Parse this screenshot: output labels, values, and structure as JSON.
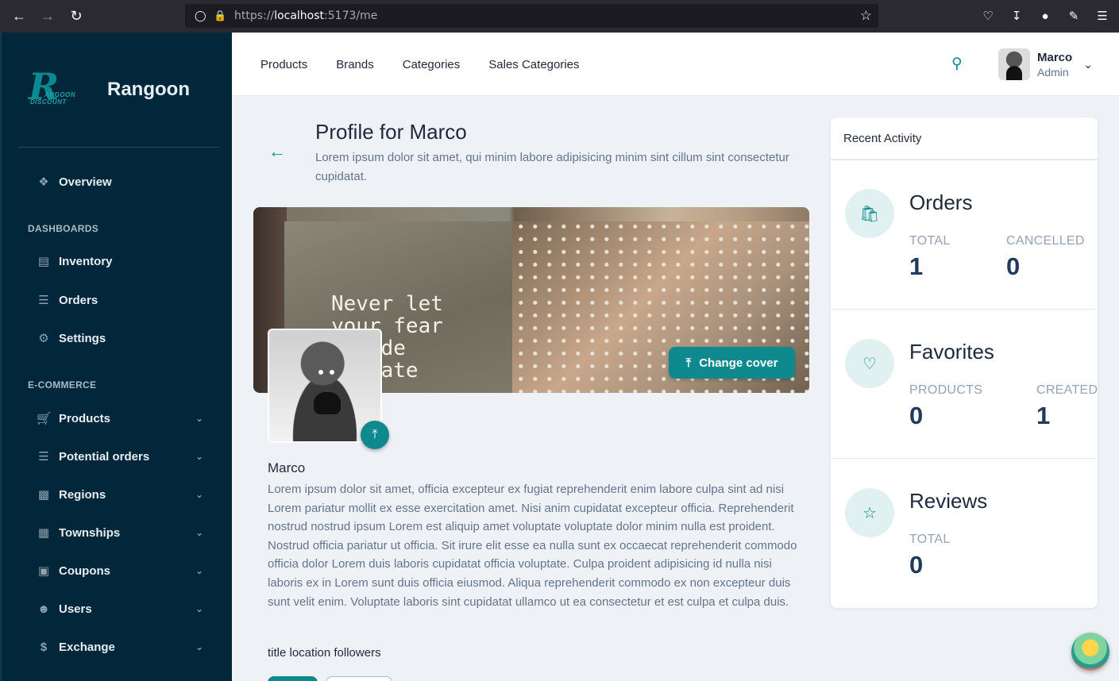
{
  "browser": {
    "url_prefix": "https://",
    "url_host": "localhost",
    "url_rest": ":5173/me",
    "icons": [
      "back-icon",
      "forward-icon",
      "reload-icon",
      "shield-icon",
      "lock-icon",
      "star-icon",
      "pocket-icon",
      "download-icon",
      "account-icon",
      "extensions-icon",
      "menu-icon"
    ]
  },
  "sidebar": {
    "brand": "Rangoon",
    "logo_text_1": "ANGOON",
    "logo_text_2": "DISCOUNT",
    "overview": "Overview",
    "section_dashboards": "DASHBOARDS",
    "dashboards": [
      {
        "label": "Inventory",
        "icon": "inventory-icon"
      },
      {
        "label": "Orders",
        "icon": "orders-icon"
      },
      {
        "label": "Settings",
        "icon": "gear-icon"
      }
    ],
    "section_ecommerce": "E-COMMERCE",
    "ecommerce": [
      {
        "label": "Products",
        "icon": "cart-icon"
      },
      {
        "label": "Potential orders",
        "icon": "list-icon"
      },
      {
        "label": "Regions",
        "icon": "bus-icon"
      },
      {
        "label": "Townships",
        "icon": "building-icon"
      },
      {
        "label": "Coupons",
        "icon": "coupon-icon"
      },
      {
        "label": "Users",
        "icon": "users-icon"
      },
      {
        "label": "Exchange",
        "icon": "dollar-icon"
      }
    ]
  },
  "topbar": {
    "nav": [
      "Products",
      "Brands",
      "Categories",
      "Sales Categories"
    ],
    "user_name": "Marco",
    "user_role": "Admin"
  },
  "profile": {
    "title": "Profile for Marco",
    "subtitle": "Lorem ipsum dolor sit amet, qui minim labore adipisicing minim sint cillum sint consectetur cupidatat.",
    "cover_quote": "Never let\nyour fear\n   ide\n   fate",
    "change_cover": "Change cover",
    "name": "Marco",
    "bio": "Lorem ipsum dolor sit amet, officia excepteur ex fugiat reprehenderit enim labore culpa sint ad nisi Lorem pariatur mollit ex esse exercitation amet. Nisi anim cupidatat excepteur officia. Reprehenderit nostrud nostrud ipsum Lorem est aliquip amet voluptate voluptate dolor minim nulla est proident. Nostrud officia pariatur ut officia. Sit irure elit esse ea nulla sunt ex occaecat reprehenderit commodo officia dolor Lorem duis laboris cupidatat officia voluptate. Culpa proident adipisicing id nulla nisi laboris ex in Lorem sunt duis officia eiusmod. Aliqua reprehenderit commodo ex non excepteur duis sunt velit enim. Voluptate laboris sint cupidatat ullamco ut ea consectetur et est culpa et culpa duis.",
    "meta": "title location followers"
  },
  "activity": {
    "title": "Recent Activity",
    "orders": {
      "title": "Orders",
      "label1": "TOTAL",
      "value1": "1",
      "label2": "CANCELLED",
      "value2": "0"
    },
    "favorites": {
      "title": "Favorites",
      "label1": "PRODUCTS",
      "value1": "0",
      "label2": "CREATED",
      "value2": "1"
    },
    "reviews": {
      "title": "Reviews",
      "label1": "TOTAL",
      "value1": "0"
    }
  },
  "colors": {
    "accent": "#0e8a8f",
    "sidebar_bg": "#02263a",
    "page_bg": "#eef2f7"
  }
}
